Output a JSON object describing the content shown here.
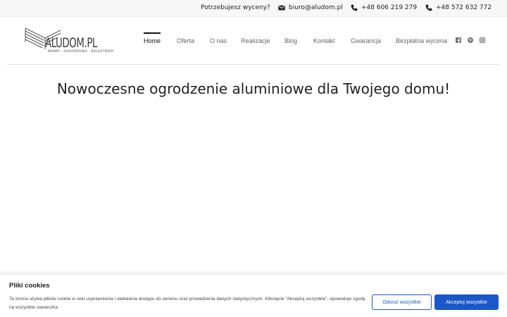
{
  "topbar": {
    "question": "Potrzebujesz wyceny?",
    "email": "biuro@aludom.pl",
    "phone1": "+48 606 219 279",
    "phone2": "+48 572 632 772"
  },
  "logo": {
    "name": "ALUDOM.PL",
    "tagline": "BRAMY · OGRODZENIA · BALUSTRADY"
  },
  "nav": {
    "items": [
      {
        "label": "Home"
      },
      {
        "label": "Oferta"
      },
      {
        "label": "O nas"
      },
      {
        "label": "Realizacje"
      },
      {
        "label": "Blog"
      },
      {
        "label": "Kontakt"
      },
      {
        "label": "Gwarancja"
      },
      {
        "label": "Bezpłatna wycena"
      }
    ],
    "active": "Home"
  },
  "social": [
    "facebook-icon",
    "pinterest-icon",
    "instagram-icon"
  ],
  "hero": {
    "title": "Nowoczesne ogrodzenie aluminiowe dla Twojego domu!"
  },
  "cookie": {
    "title": "Pliki cookies",
    "text": "Ta strona używa plików cookie w celu usprawnienia i ułatwienia dostępu do serwisu oraz prowadzenia danych statystycznych. Kliknięcie \"Akceptuj wszystkie\", spowoduje zgodę na wszystkie ciasteczka.",
    "reject_label": "Odrzuć wszystkie",
    "accept_label": "Akceptuj wszystkie"
  },
  "colors": {
    "accent": "#1a57c8",
    "topbar_bg": "#f7f7f7"
  }
}
